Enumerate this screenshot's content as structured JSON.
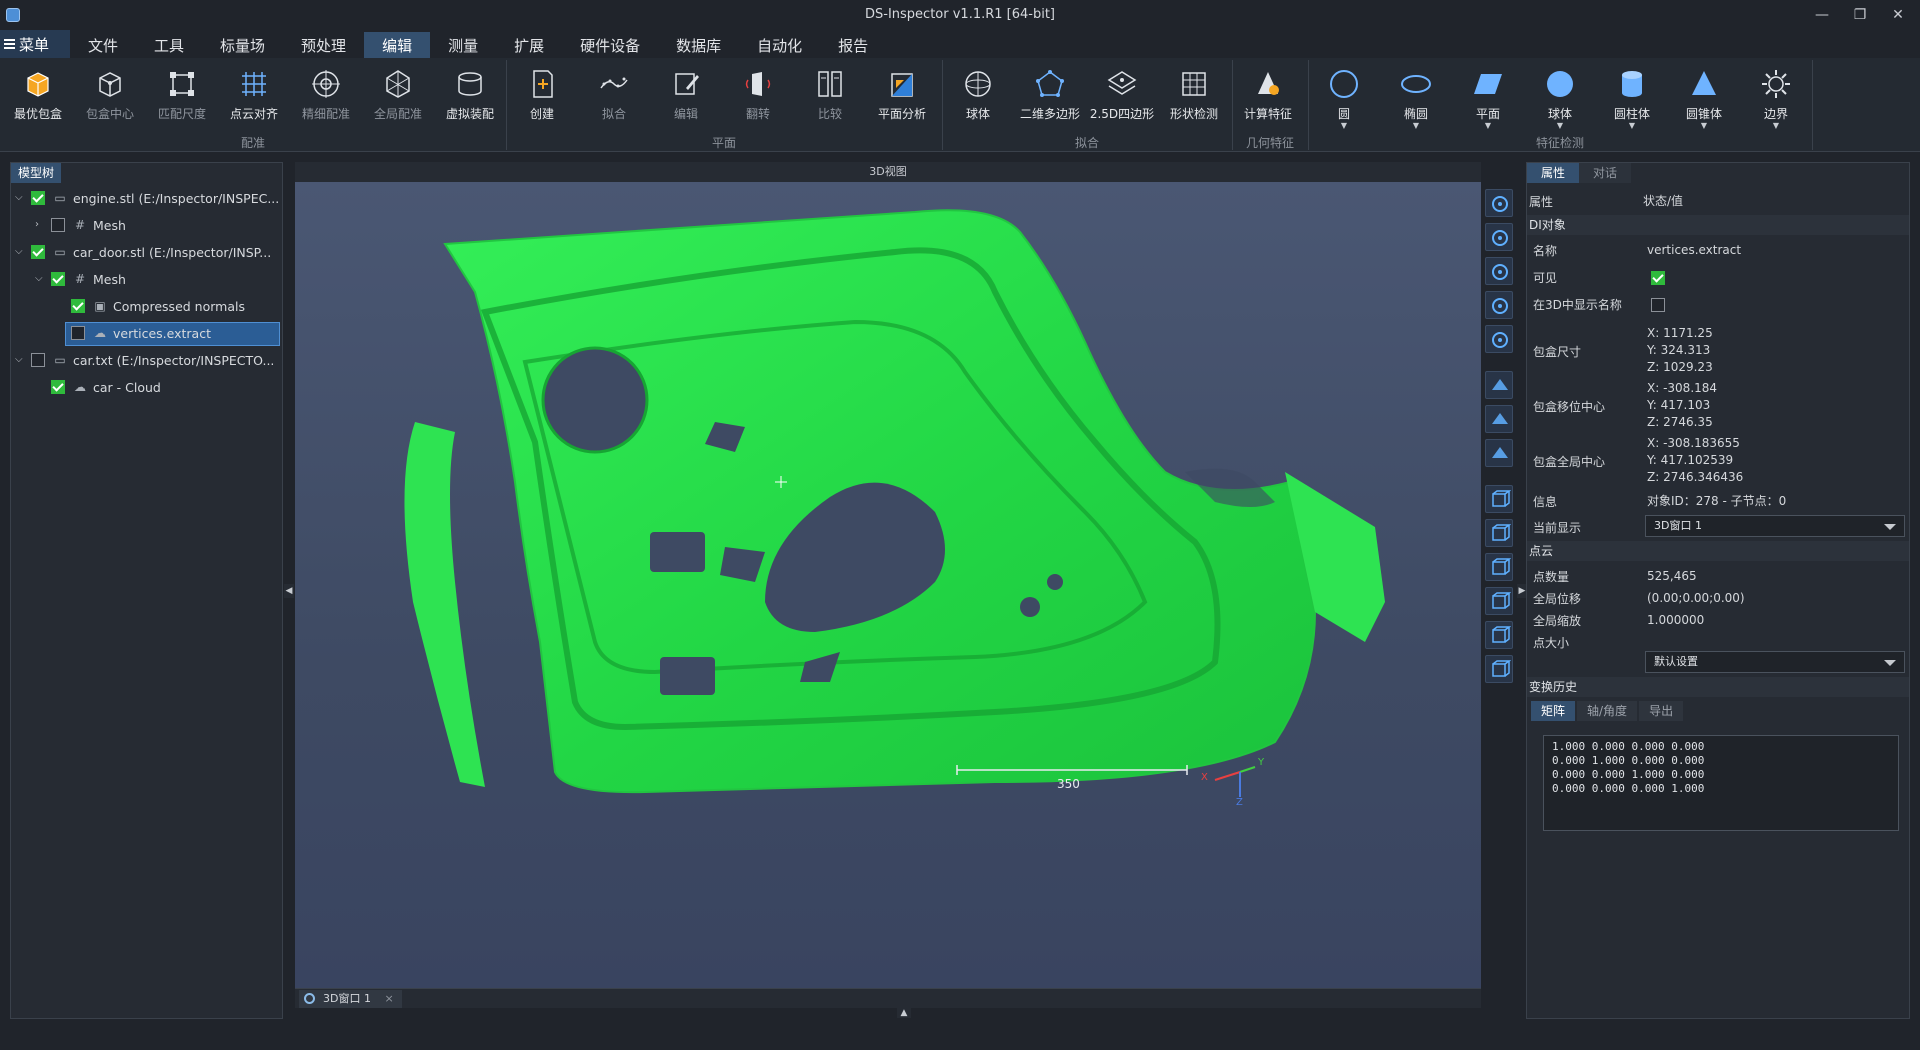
{
  "window": {
    "title": "DS-Inspector v1.1.R1 [64-bit]"
  },
  "menubar": {
    "main_menu": "菜单",
    "items": [
      "文件",
      "工具",
      "标量场",
      "预处理",
      "编辑",
      "测量",
      "扩展",
      "硬件设备",
      "数据库",
      "自动化",
      "报告"
    ],
    "active_index": 4
  },
  "ribbon": {
    "groups": [
      {
        "label": "配准",
        "buttons": [
          {
            "label": "最优包盒",
            "icon": "box-icon",
            "dim": false
          },
          {
            "label": "包盒中心",
            "icon": "cube-center-icon",
            "dim": true
          },
          {
            "label": "匹配尺度",
            "icon": "scale-match-icon",
            "dim": true
          },
          {
            "label": "点云对齐",
            "icon": "grid-align-icon",
            "dim": false
          },
          {
            "label": "精细配准",
            "icon": "fine-register-icon",
            "dim": true
          },
          {
            "label": "全局配准",
            "icon": "global-register-icon",
            "dim": true
          },
          {
            "label": "虚拟装配",
            "icon": "cylinder-assembly-icon",
            "dim": false
          }
        ]
      },
      {
        "label": "平面",
        "buttons": [
          {
            "label": "创建",
            "icon": "plane-create-icon",
            "dim": false
          },
          {
            "label": "拟合",
            "icon": "fit-curve-icon",
            "dim": true
          },
          {
            "label": "编辑",
            "icon": "edit-icon",
            "dim": true
          },
          {
            "label": "翻转",
            "icon": "flip-icon",
            "dim": true
          },
          {
            "label": "比较",
            "icon": "compare-icon",
            "dim": true
          },
          {
            "label": "平面分析",
            "icon": "plane-analysis-icon",
            "dim": false
          }
        ]
      },
      {
        "label": "拟合",
        "buttons": [
          {
            "label": "球体",
            "icon": "sphere-fit-icon",
            "dim": false
          },
          {
            "label": "二维多边形",
            "icon": "polygon-icon",
            "dim": false
          },
          {
            "label": "2.5D四边形",
            "icon": "quad-icon",
            "dim": false
          },
          {
            "label": "形状检测",
            "icon": "shape-detect-icon",
            "dim": false
          }
        ]
      },
      {
        "label": "几何特征",
        "buttons": [
          {
            "label": "计算特征",
            "icon": "compute-feature-icon",
            "dim": false
          }
        ]
      },
      {
        "label": "特征检测",
        "buttons": [
          {
            "label": "圆",
            "icon": "circle-icon",
            "dim": false
          },
          {
            "label": "椭圆",
            "icon": "ellipse-icon",
            "dim": false
          },
          {
            "label": "平面",
            "icon": "plane-icon",
            "dim": false
          },
          {
            "label": "球体",
            "icon": "sphere-icon",
            "dim": false
          },
          {
            "label": "圆柱体",
            "icon": "cylinder-icon",
            "dim": false
          },
          {
            "label": "圆锥体",
            "icon": "cone-icon",
            "dim": false
          },
          {
            "label": "边界",
            "icon": "boundary-icon",
            "dim": false
          }
        ]
      }
    ]
  },
  "left_panel": {
    "tab": "模型树",
    "tree": [
      {
        "label": "engine.stl (E:/Inspector/INSPEC...",
        "level": 0,
        "arrow": "down",
        "checked": true,
        "icon": "file-icon"
      },
      {
        "label": "Mesh",
        "level": 1,
        "arrow": "right",
        "checked": false,
        "icon": "mesh-icon"
      },
      {
        "label": "car_door.stl (E:/Inspector/INSP...",
        "level": 0,
        "arrow": "down",
        "checked": true,
        "icon": "file-icon"
      },
      {
        "label": "Mesh",
        "level": 1,
        "arrow": "down",
        "checked": true,
        "icon": "mesh-icon"
      },
      {
        "label": "Compressed normals",
        "level": 2,
        "arrow": "",
        "checked": true,
        "icon": "normals-icon"
      },
      {
        "label": "vertices.extract",
        "level": 2,
        "arrow": "",
        "checked": false,
        "icon": "cloud-icon",
        "selected": true
      },
      {
        "label": "car.txt (E:/Inspector/INSPECTO...",
        "level": 0,
        "arrow": "down",
        "checked": false,
        "icon": "file-icon"
      },
      {
        "label": "car - Cloud",
        "level": 1,
        "arrow": "",
        "checked": true,
        "icon": "cloud-icon"
      }
    ]
  },
  "viewport": {
    "header": "3D视图",
    "scale_label": "350",
    "axis_labels": {
      "x": "X",
      "y": "Y",
      "z": "Z"
    },
    "mesh_color": "#2fe34f",
    "tab": "3D窗口 1"
  },
  "right_panel": {
    "tabs": [
      "属性",
      "对话"
    ],
    "header": {
      "key": "属性",
      "value": "状态/值"
    },
    "sections": {
      "db_object": "DI对象",
      "point_cloud": "点云",
      "transform_history": "变换历史"
    },
    "props": {
      "name_k": "名称",
      "name_v": "vertices.extract",
      "visible_k": "可见",
      "visible_v": true,
      "show_name_k": "在3D中显示名称",
      "show_name_v": false,
      "bbox_size_k": "包盒尺寸",
      "bbox_size_v": [
        "X: 1171.25",
        "Y: 324.313",
        "Z: 1029.23"
      ],
      "bbox_shift_k": "包盒移位中心",
      "bbox_shift_v": [
        "X: -308.184",
        "Y: 417.103",
        "Z: 2746.35"
      ],
      "bbox_global_k": "包盒全局中心",
      "bbox_global_v": [
        "X: -308.183655",
        "Y: 417.102539",
        "Z: 2746.346436"
      ],
      "info_k": "信息",
      "info_v": "对象ID：278 - 子节点：0",
      "display_k": "当前显示",
      "display_v": "3D窗口 1",
      "points_k": "点数量",
      "points_v": "525,465",
      "gshift_k": "全局位移",
      "gshift_v": "(0.00;0.00;0.00)",
      "gscale_k": "全局缩放",
      "gscale_v": "1.000000",
      "psize_k": "点大小",
      "psize_v": "默认设置"
    },
    "subtabs": [
      "矩阵",
      "轴/角度",
      "导出"
    ],
    "matrix": [
      "1.000 0.000 0.000 0.000",
      "0.000 1.000 0.000 0.000",
      "0.000 0.000 1.000 0.000",
      "0.000 0.000 0.000 1.000"
    ]
  }
}
